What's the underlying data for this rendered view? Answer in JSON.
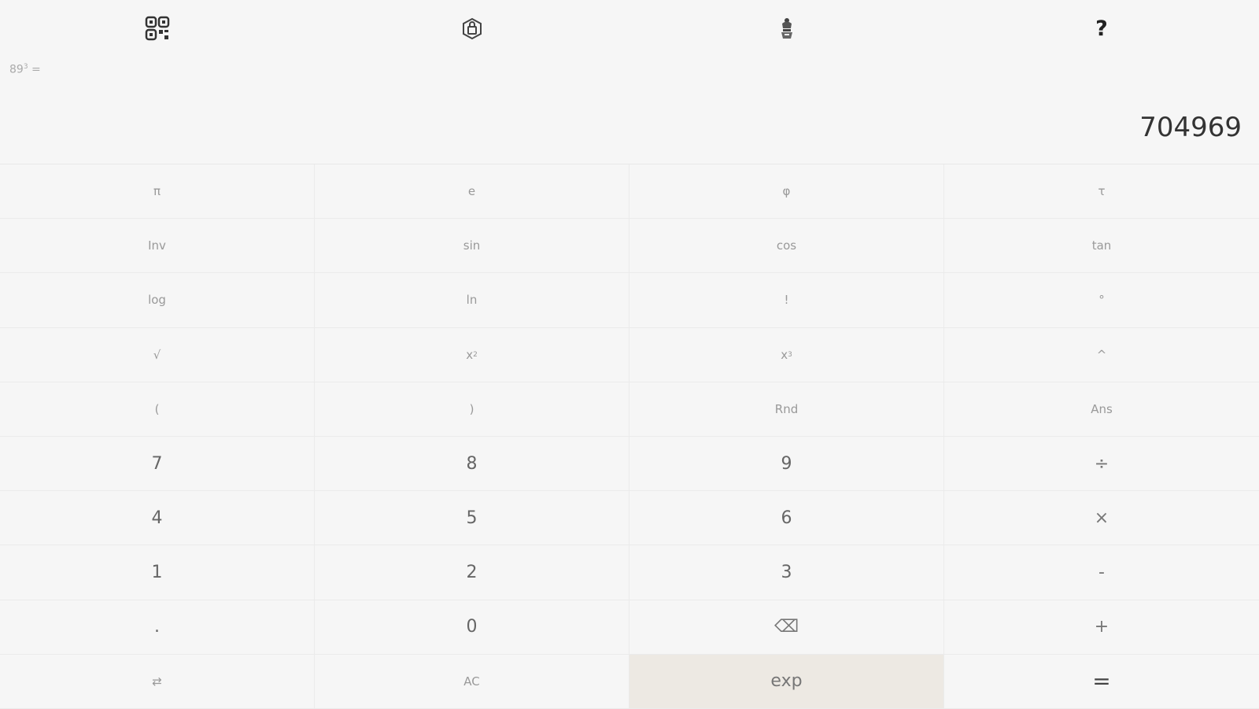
{
  "toolbar": {
    "icons": [
      "qr-code-icon",
      "cube-lock-icon",
      "emblem-icon",
      "help-icon"
    ],
    "help_label": "?"
  },
  "display": {
    "expression": "89",
    "expression_exponent": "3",
    "expression_suffix": "=",
    "result": "704969"
  },
  "keys": [
    {
      "label": "π",
      "kind": "fn"
    },
    {
      "label": "e",
      "kind": "fn"
    },
    {
      "label": "φ",
      "kind": "fn"
    },
    {
      "label": "τ",
      "kind": "fn"
    },
    {
      "label": "Inv",
      "kind": "fn"
    },
    {
      "label": "sin",
      "kind": "fn"
    },
    {
      "label": "cos",
      "kind": "fn"
    },
    {
      "label": "tan",
      "kind": "fn"
    },
    {
      "label": "log",
      "kind": "fn"
    },
    {
      "label": "ln",
      "kind": "fn"
    },
    {
      "label": "!",
      "kind": "fn"
    },
    {
      "label": "°",
      "kind": "fn"
    },
    {
      "label": "√",
      "kind": "fn"
    },
    {
      "label": "x",
      "sup": "2",
      "kind": "fn"
    },
    {
      "label": "x",
      "sup": "3",
      "kind": "fn"
    },
    {
      "label": "^",
      "kind": "fn"
    },
    {
      "label": "(",
      "kind": "fn"
    },
    {
      "label": ")",
      "kind": "fn"
    },
    {
      "label": "Rnd",
      "kind": "fn"
    },
    {
      "label": "Ans",
      "kind": "fn"
    },
    {
      "label": "7",
      "kind": "num"
    },
    {
      "label": "8",
      "kind": "num"
    },
    {
      "label": "9",
      "kind": "num"
    },
    {
      "label": "÷",
      "kind": "op"
    },
    {
      "label": "4",
      "kind": "num"
    },
    {
      "label": "5",
      "kind": "num"
    },
    {
      "label": "6",
      "kind": "num"
    },
    {
      "label": "×",
      "kind": "op"
    },
    {
      "label": "1",
      "kind": "num"
    },
    {
      "label": "2",
      "kind": "num"
    },
    {
      "label": "3",
      "kind": "num"
    },
    {
      "label": "-",
      "kind": "op"
    },
    {
      "label": ".",
      "kind": "num"
    },
    {
      "label": "0",
      "kind": "num"
    },
    {
      "label": "⌫",
      "kind": "op"
    },
    {
      "label": "+",
      "kind": "op"
    },
    {
      "label": "⇄",
      "kind": "fn"
    },
    {
      "label": "AC",
      "kind": "fn"
    },
    {
      "label": "exp",
      "kind": "hl"
    },
    {
      "label": "=",
      "kind": "eq"
    }
  ],
  "colors": {
    "background": "#f6f6f6",
    "highlight_key": "#ede9e3",
    "result_text": "#333333"
  }
}
